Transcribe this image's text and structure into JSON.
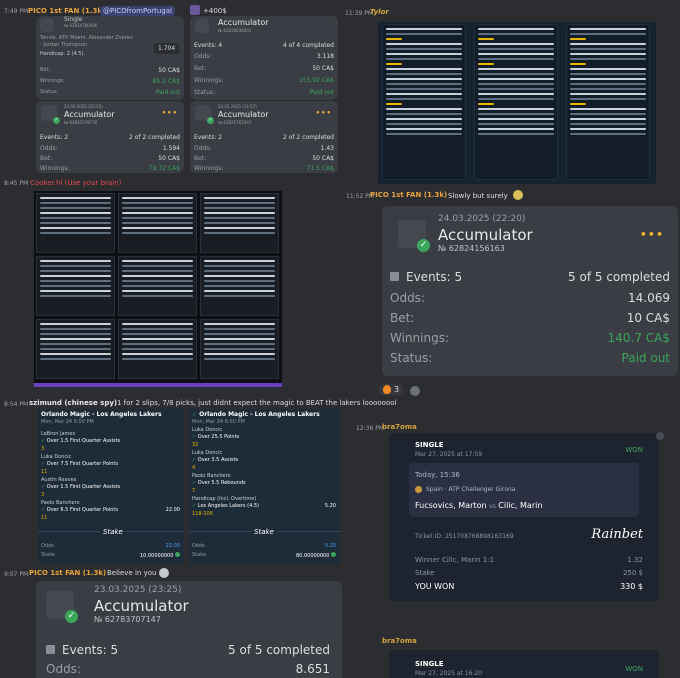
{
  "messages": {
    "m1": {
      "time": "7:49 PM",
      "user": "PICO 1st FAN (1.3k)",
      "mention": "@PICOfromPortugal",
      "extra": "+400$"
    },
    "m2": {
      "time": "11:39 PM",
      "user": "Tylor"
    },
    "m3": {
      "time": "8:45 PM",
      "user": "Cooker.hl (Use your brain)"
    },
    "m4": {
      "time": "11:52 PM",
      "user": "PICO 1st FAN (1.3k)",
      "text": "Slowly but surely"
    },
    "m5": {
      "time": "8:54 PM",
      "user": "szimund (chinese spy)",
      "text": "1 for 2 slips, 7/8 picks, just didnt expect the magic to BEAT the lakers loooooool"
    },
    "m6": {
      "time": "12:36 PM",
      "user": "bra7oma"
    },
    "m7": {
      "time": "9:07 PM",
      "user": "PICO 1st FAN (1.3k)",
      "text": "Believe in you"
    },
    "m8": {
      "user": "bra7oma"
    }
  },
  "reaction": {
    "emoji": "fire",
    "count": "3"
  },
  "slip_a": {
    "single": "Single",
    "number": "№ 62834780946",
    "desc": "Tennis. ATP. Miami. Alexander Zverev - Jordan Thompson",
    "handicap": "Handicap. 2 (4.5).",
    "odds": "1.704",
    "bet_label": "Bet:",
    "bet": "50 CA$",
    "win_label": "Winnings:",
    "win": "85.2 CA$",
    "status_label": "Status:",
    "status": "Paid out"
  },
  "slip_b": {
    "title": "Accumulator",
    "number": "№ 62834036001",
    "events_label": "Events: 4",
    "events_done": "4 of 4 completed",
    "odds_label": "Odds:",
    "odds": "3.118",
    "bet_label": "Bet:",
    "bet": "50 CA$",
    "win_label": "Winnings:",
    "win": "155.92 CA$",
    "status_label": "Status:",
    "status": "Paid out"
  },
  "slip_c": {
    "date": "24.03.2025 (22:05)",
    "title": "Accumulator",
    "number": "№ 62835378776",
    "events_label": "Events: 2",
    "events_done": "2 of 2 completed",
    "odds_label": "Odds:",
    "odds": "1.594",
    "bet_label": "Bet:",
    "bet": "50 CA$",
    "win_label": "Winnings:",
    "win": "79.72 CA$"
  },
  "slip_d": {
    "date": "24.03.2025 (11:57)",
    "title": "Accumulator",
    "number": "№ 62835767047",
    "events_label": "Events: 2",
    "events_done": "2 of 2 completed",
    "odds_label": "Odds:",
    "odds": "1.43",
    "bet_label": "Bet:",
    "bet": "50 CA$",
    "win_label": "Winnings:",
    "win": "71.5 CA$"
  },
  "slip_big": {
    "date": "24.03.2025 (22:20)",
    "title": "Accumulator",
    "number": "№ 62824156163",
    "events_label": "Events: 5",
    "events_done": "5 of 5 completed",
    "odds_label": "Odds:",
    "odds": "14.069",
    "bet_label": "Bet:",
    "bet": "10 CA$",
    "win_label": "Winnings:",
    "win": "140.7 CA$",
    "status_label": "Status:",
    "status": "Paid out"
  },
  "slip_bottom": {
    "date": "23.03.2025 (23:25)",
    "title": "Accumulator",
    "number": "№ 62783707147",
    "events_label": "Events: 5",
    "events_done": "5 of 5 completed",
    "odds_label": "Odds:",
    "odds": "8.651"
  },
  "stake1": {
    "game": "Orlando Magic - Los Angeles Lakers",
    "date": "Mon, Mar 24 6:00 PM",
    "legs": [
      {
        "player": "LeBron James",
        "pick": "Over 1.5 First Quarter Assists",
        "val": "3"
      },
      {
        "player": "Luka Doncic",
        "pick": "Over 7.5 First Quarter Points",
        "val": "11"
      },
      {
        "player": "Austin Reaves",
        "pick": "Over 1.5 First Quarter Assists",
        "val": "3"
      },
      {
        "player": "Paolo Banchero",
        "pick": "Over 6.5 First Quarter Points",
        "val": "11"
      }
    ],
    "odd_last": "22.00",
    "logo": "Stake",
    "odds_label": "Odds",
    "odds": "22.00",
    "stake_label": "Stake",
    "stake": "10.00000000"
  },
  "stake2": {
    "game": "Orlando Magic - Los Angeles Lakers",
    "date": "Mon, Mar 24 6:00 PM",
    "legs": [
      {
        "player": "Luka Doncic",
        "pick": "Over 25.5 Points",
        "val": "32"
      },
      {
        "player": "Luka Doncic",
        "pick": "Over 3.5 Assists",
        "val": "4"
      },
      {
        "player": "Paolo Banchero",
        "pick": "Over 5.5 Rebounds",
        "val": "7"
      }
    ],
    "handicap": "Handicap (Incl. Overtime)",
    "handicap_pick": "Los Angeles Lakers (4.5)",
    "handicap_odds": "5.20",
    "score": "118-106",
    "logo": "Stake",
    "odds_label": "Odds",
    "odds": "5.20",
    "stake_label": "Stake",
    "stake": "80.00000000"
  },
  "rainbet1": {
    "type": "SINGLE",
    "placed": "Mar 27, 2025 at 17:59",
    "result": "WON",
    "when": "Today, 15:36",
    "league": "Spain · ATP Challenger Girona",
    "player1": "Fucsovics, Marton",
    "vs": "vs",
    "player2": "Cilic, Marin",
    "brand": "Rainbet",
    "ticket": "Ticket ID: 251708768898163169",
    "pick": "Winner Cilic, Marin  1:1",
    "pick_odds": "1.32",
    "stake_label": "Stake",
    "stake": "250 $",
    "won_label": "YOU WON",
    "won": "330 $"
  },
  "rainbet2": {
    "type": "SINGLE",
    "placed": "Mar 27, 2025 at 16:20",
    "result": "WON"
  },
  "colors": {
    "accent_green": "#3ba55c",
    "gold": "#f0b232",
    "pico_orange": "#e8a33b",
    "cooker_red": "#e5484d",
    "tylor_gold": "#d4a63a"
  }
}
